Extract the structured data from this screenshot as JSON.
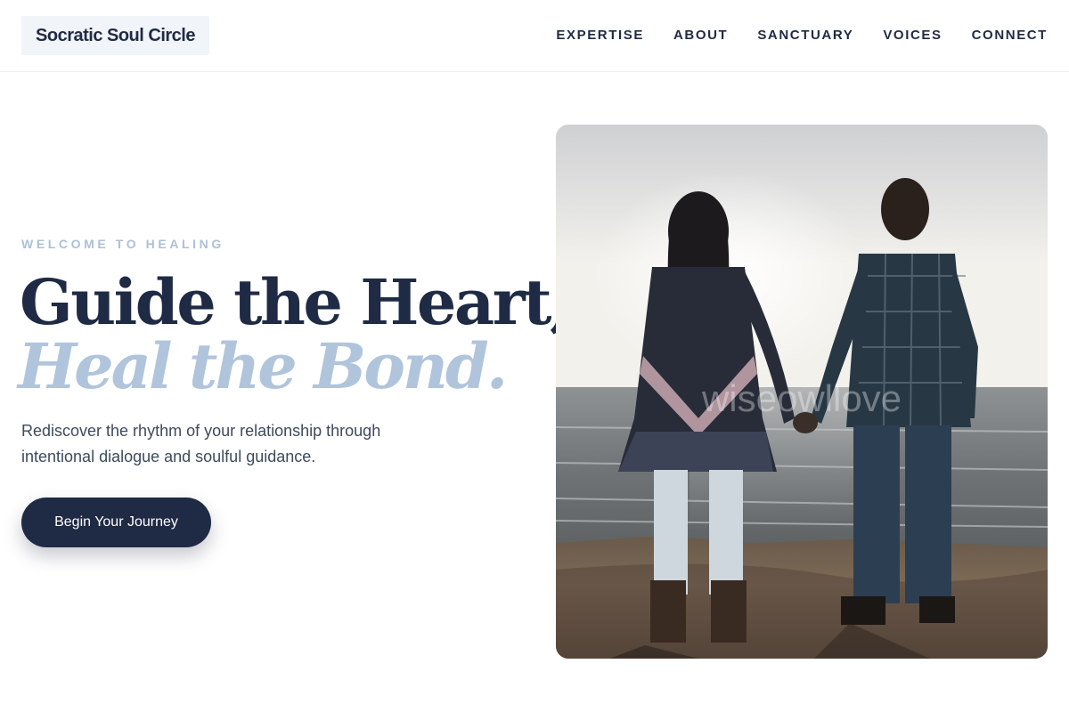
{
  "header": {
    "brand": "Socratic Soul Circle",
    "nav": [
      "EXPERTISE",
      "ABOUT",
      "SANCTUARY",
      "VOICES",
      "CONNECT"
    ]
  },
  "hero": {
    "eyebrow": "WELCOME TO HEALING",
    "headline_line1": "Guide the Heart,",
    "headline_line2": "Heal the Bond.",
    "subtext": "Rediscover the rhythm of your relationship through intentional dialogue and soulful guidance.",
    "cta_label": "Begin Your Journey",
    "image_watermark": "wiseowllove"
  },
  "colors": {
    "navy": "#1f2a44",
    "accent_blue": "#b0c4dc",
    "eyebrow_blue": "#aec0d6",
    "brand_bg": "#f1f4f8"
  }
}
